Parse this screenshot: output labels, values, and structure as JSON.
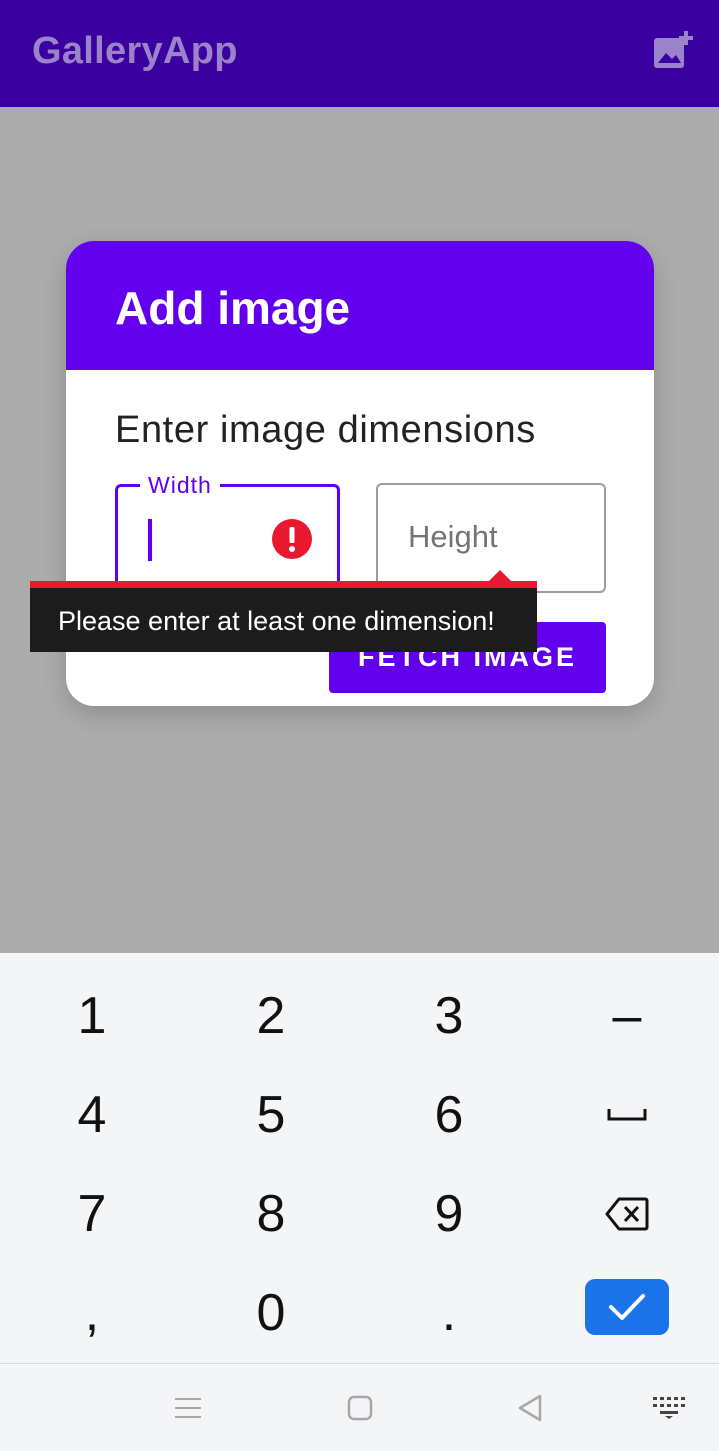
{
  "app_bar": {
    "title": "GalleryApp",
    "action_icon": "add-photo-icon",
    "background": "#3a00a0"
  },
  "dialog": {
    "title": "Add image",
    "subtitle": "Enter image dimensions",
    "accent_color": "#6200ee",
    "width_field": {
      "label": "Width",
      "value": "",
      "error_icon": "error-icon",
      "error_color": "#e8182f"
    },
    "height_field": {
      "placeholder": "Height",
      "value": ""
    },
    "fetch_button_label": "FETCH IMAGE"
  },
  "error_popup": {
    "message": "Please enter at least one dimension!"
  },
  "keyboard": {
    "rows": [
      [
        "1",
        "2",
        "3",
        "–"
      ],
      [
        "4",
        "5",
        "6",
        "space"
      ],
      [
        "7",
        "8",
        "9",
        "backspace"
      ],
      [
        ",",
        "0",
        ".",
        "done"
      ]
    ],
    "keys": {
      "k1": "1",
      "k2": "2",
      "k3": "3",
      "dash": "–",
      "k4": "4",
      "k5": "5",
      "k6": "6",
      "k7": "7",
      "k8": "8",
      "k9": "9",
      "comma": ",",
      "k0": "0",
      "period": "."
    },
    "done_color": "#1a73e8"
  },
  "nav_bar": {
    "icons": [
      "menu-icon",
      "home-square-icon",
      "back-triangle-icon",
      "keyboard-icon"
    ]
  }
}
